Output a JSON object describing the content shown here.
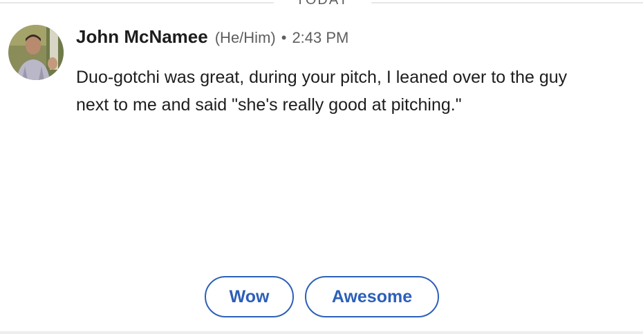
{
  "divider": {
    "label": "TODAY"
  },
  "message": {
    "author": "John McNamee",
    "pronouns": "(He/Him)",
    "separator": "•",
    "time": "2:43 PM",
    "text": "Duo-gotchi was great, during your pitch, I leaned over to the guy next to me and said \"she's really good at pitching.\""
  },
  "quick_replies": [
    {
      "label": "Wow"
    },
    {
      "label": "Awesome"
    }
  ],
  "colors": {
    "accent": "#2c5fb8",
    "text_primary": "#1d1d1d",
    "text_secondary": "#5e5e5e"
  }
}
